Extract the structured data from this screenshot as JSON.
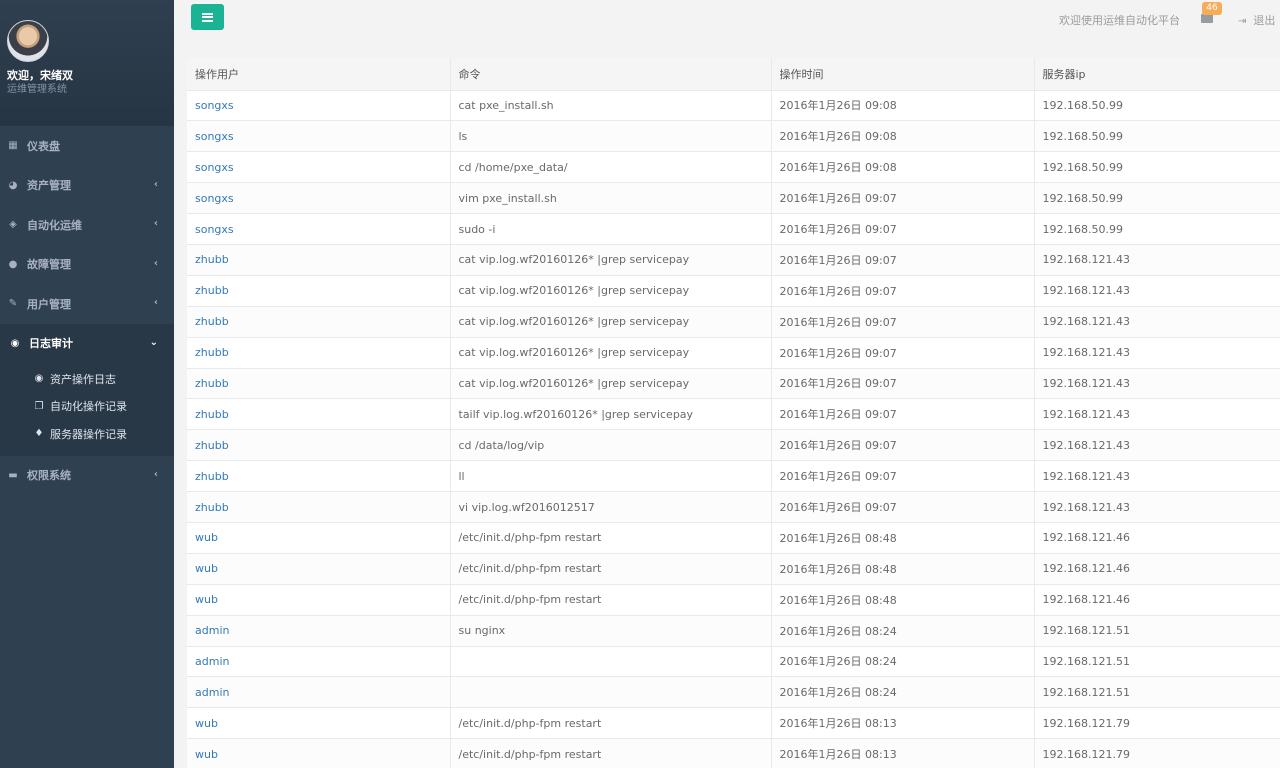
{
  "profile": {
    "welcome": "欢迎，宋绪双",
    "subtitle": "运维管理系统"
  },
  "sidebar": {
    "items": [
      {
        "label": "仪表盘",
        "icon": "th-large-icon",
        "glyph": "▦",
        "chevron": ""
      },
      {
        "label": "资产管理",
        "icon": "pie-chart-icon",
        "glyph": "◕",
        "chevron": "‹"
      },
      {
        "label": "自动化运维",
        "icon": "cube-icon",
        "glyph": "◈",
        "chevron": "‹"
      },
      {
        "label": "故障管理",
        "icon": "bomb-icon",
        "glyph": "●",
        "chevron": "‹"
      },
      {
        "label": "用户管理",
        "icon": "edit-icon",
        "glyph": "✎",
        "chevron": "‹"
      },
      {
        "label": "日志审计",
        "icon": "eye-icon",
        "glyph": "◉",
        "chevron": "⌄"
      },
      {
        "label": "权限系统",
        "icon": "briefcase-icon",
        "glyph": "▬",
        "chevron": "‹"
      }
    ],
    "submenu": [
      {
        "label": "资产操作日志",
        "icon": "eye-icon",
        "glyph": "◉"
      },
      {
        "label": "自动化操作记录",
        "icon": "files-icon",
        "glyph": "❐"
      },
      {
        "label": "服务器操作记录",
        "icon": "tint-icon",
        "glyph": "♦"
      }
    ]
  },
  "topbar": {
    "welcome": "欢迎使用运维自动化平台",
    "mail_badge": "46",
    "logout": "退出"
  },
  "table": {
    "headers": [
      "操作用户",
      "命令",
      "操作时间",
      "服务器ip"
    ],
    "rows": [
      [
        "songxs",
        "cat pxe_install.sh",
        "2016年1月26日 09:08",
        "192.168.50.99"
      ],
      [
        "songxs",
        "ls",
        "2016年1月26日 09:08",
        "192.168.50.99"
      ],
      [
        "songxs",
        "cd /home/pxe_data/",
        "2016年1月26日 09:08",
        "192.168.50.99"
      ],
      [
        "songxs",
        "vim pxe_install.sh",
        "2016年1月26日 09:07",
        "192.168.50.99"
      ],
      [
        "songxs",
        "sudo -i",
        "2016年1月26日 09:07",
        "192.168.50.99"
      ],
      [
        "zhubb",
        "cat vip.log.wf20160126* |grep servicepay",
        "2016年1月26日 09:07",
        "192.168.121.43"
      ],
      [
        "zhubb",
        "cat vip.log.wf20160126* |grep servicepay",
        "2016年1月26日 09:07",
        "192.168.121.43"
      ],
      [
        "zhubb",
        "cat vip.log.wf20160126* |grep servicepay",
        "2016年1月26日 09:07",
        "192.168.121.43"
      ],
      [
        "zhubb",
        "cat vip.log.wf20160126* |grep servicepay",
        "2016年1月26日 09:07",
        "192.168.121.43"
      ],
      [
        "zhubb",
        "cat vip.log.wf20160126* |grep servicepay",
        "2016年1月26日 09:07",
        "192.168.121.43"
      ],
      [
        "zhubb",
        "tailf vip.log.wf20160126* |grep servicepay",
        "2016年1月26日 09:07",
        "192.168.121.43"
      ],
      [
        "zhubb",
        "cd /data/log/vip",
        "2016年1月26日 09:07",
        "192.168.121.43"
      ],
      [
        "zhubb",
        "ll",
        "2016年1月26日 09:07",
        "192.168.121.43"
      ],
      [
        "zhubb",
        "vi vip.log.wf2016012517",
        "2016年1月26日 09:07",
        "192.168.121.43"
      ],
      [
        "wub",
        "/etc/init.d/php-fpm restart",
        "2016年1月26日 08:48",
        "192.168.121.46"
      ],
      [
        "wub",
        "/etc/init.d/php-fpm restart",
        "2016年1月26日 08:48",
        "192.168.121.46"
      ],
      [
        "wub",
        "/etc/init.d/php-fpm restart",
        "2016年1月26日 08:48",
        "192.168.121.46"
      ],
      [
        "admin",
        "su nginx",
        "2016年1月26日 08:24",
        "192.168.121.51"
      ],
      [
        "admin",
        "",
        "2016年1月26日 08:24",
        "192.168.121.51"
      ],
      [
        "admin",
        "",
        "2016年1月26日 08:24",
        "192.168.121.51"
      ],
      [
        "wub",
        "/etc/init.d/php-fpm restart",
        "2016年1月26日 08:13",
        "192.168.121.79"
      ],
      [
        "wub",
        "/etc/init.d/php-fpm restart",
        "2016年1月26日 08:13",
        "192.168.121.79"
      ]
    ]
  }
}
